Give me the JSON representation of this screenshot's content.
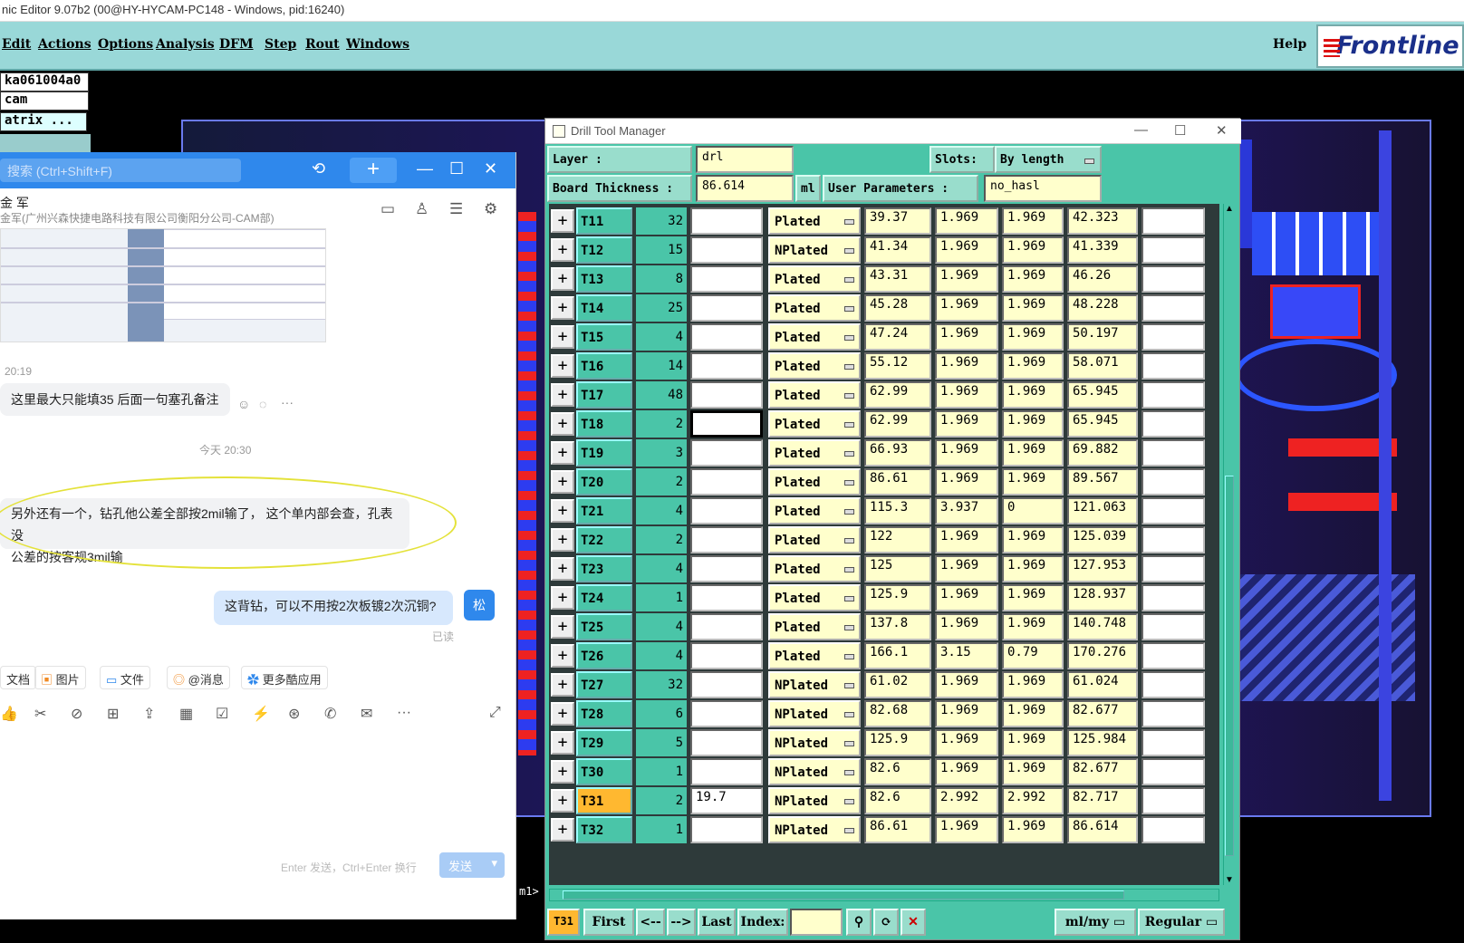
{
  "window": {
    "title": "nic Editor 9.07b2 (00@HY-HYCAM-PC148 - Windows, pid:16240)"
  },
  "menu": {
    "items": [
      "Edit",
      "Actions",
      "Options",
      "Analysis",
      "DFM",
      "Step",
      "Rout",
      "Windows"
    ],
    "help": "Help",
    "logo": "Frontline"
  },
  "left_panel": {
    "job": "ka061004a0",
    "user": "cam",
    "matrix": "atrix ...",
    "coords": "m1>"
  },
  "chat": {
    "search_placeholder": "搜索 (Ctrl+Shift+F)",
    "plus_label": "+",
    "contact_name": "金  军",
    "contact_org": "金军(广州兴森快捷电路科技有限公司衡阳分公司-CAM部)",
    "time1": "20:19",
    "msg1": "这里最大只能填35 后面一句塞孔备注",
    "time2": "今天 20:30",
    "msg2_line1": "另外还有一个，钻孔他公差全部按2mil输了， 这个单内部会查，孔表没",
    "msg2_line2": "公差的按客规3mil输",
    "my_msg": "这背钻，可以不用按2次板镀2次沉铜?",
    "my_avatar": "松",
    "read": "已读",
    "chips": [
      "文档",
      "图片",
      "文件",
      "@消息",
      "更多酷应用"
    ],
    "send_hint": "Enter 发送，Ctrl+Enter 换行",
    "send": "发送"
  },
  "dtm": {
    "title": "Drill Tool Manager",
    "layer_label": "Layer        :",
    "layer_value": "drl",
    "slots_label": "Slots:",
    "slots_value": "By length",
    "thick_label": "Board Thickness  :",
    "thick_value": "86.614",
    "thick_unit": "ml",
    "user_params_label": "User Parameters  :",
    "user_params_value": "no_hasl",
    "rows": [
      {
        "tool": "T11",
        "count": "32",
        "finish": "",
        "type": "Plated",
        "d1": "39.37",
        "d2": "1.969",
        "d3": "1.969",
        "d4": "42.323",
        "d5": ""
      },
      {
        "tool": "T12",
        "count": "15",
        "finish": "",
        "type": "NPlated",
        "d1": "41.34",
        "d2": "1.969",
        "d3": "1.969",
        "d4": "41.339",
        "d5": ""
      },
      {
        "tool": "T13",
        "count": "8",
        "finish": "",
        "type": "Plated",
        "d1": "43.31",
        "d2": "1.969",
        "d3": "1.969",
        "d4": "46.26",
        "d5": ""
      },
      {
        "tool": "T14",
        "count": "25",
        "finish": "",
        "type": "Plated",
        "d1": "45.28",
        "d2": "1.969",
        "d3": "1.969",
        "d4": "48.228",
        "d5": ""
      },
      {
        "tool": "T15",
        "count": "4",
        "finish": "",
        "type": "Plated",
        "d1": "47.24",
        "d2": "1.969",
        "d3": "1.969",
        "d4": "50.197",
        "d5": ""
      },
      {
        "tool": "T16",
        "count": "14",
        "finish": "",
        "type": "Plated",
        "d1": "55.12",
        "d2": "1.969",
        "d3": "1.969",
        "d4": "58.071",
        "d5": ""
      },
      {
        "tool": "T17",
        "count": "48",
        "finish": "",
        "type": "Plated",
        "d1": "62.99",
        "d2": "1.969",
        "d3": "1.969",
        "d4": "65.945",
        "d5": ""
      },
      {
        "tool": "T18",
        "count": "2",
        "finish": "",
        "type": "Plated",
        "d1": "62.99",
        "d2": "1.969",
        "d3": "1.969",
        "d4": "65.945",
        "d5": ""
      },
      {
        "tool": "T19",
        "count": "3",
        "finish": "",
        "type": "Plated",
        "d1": "66.93",
        "d2": "1.969",
        "d3": "1.969",
        "d4": "69.882",
        "d5": ""
      },
      {
        "tool": "T20",
        "count": "2",
        "finish": "",
        "type": "Plated",
        "d1": "86.61",
        "d2": "1.969",
        "d3": "1.969",
        "d4": "89.567",
        "d5": ""
      },
      {
        "tool": "T21",
        "count": "4",
        "finish": "",
        "type": "Plated",
        "d1": "115.3",
        "d2": "3.937",
        "d3": "0",
        "d4": "121.063",
        "d5": ""
      },
      {
        "tool": "T22",
        "count": "2",
        "finish": "",
        "type": "Plated",
        "d1": "122",
        "d2": "1.969",
        "d3": "1.969",
        "d4": "125.039",
        "d5": ""
      },
      {
        "tool": "T23",
        "count": "4",
        "finish": "",
        "type": "Plated",
        "d1": "125",
        "d2": "1.969",
        "d3": "1.969",
        "d4": "127.953",
        "d5": ""
      },
      {
        "tool": "T24",
        "count": "1",
        "finish": "",
        "type": "Plated",
        "d1": "125.9",
        "d2": "1.969",
        "d3": "1.969",
        "d4": "128.937",
        "d5": ""
      },
      {
        "tool": "T25",
        "count": "4",
        "finish": "",
        "type": "Plated",
        "d1": "137.8",
        "d2": "1.969",
        "d3": "1.969",
        "d4": "140.748",
        "d5": ""
      },
      {
        "tool": "T26",
        "count": "4",
        "finish": "",
        "type": "Plated",
        "d1": "166.1",
        "d2": "3.15",
        "d3": "0.79",
        "d4": "170.276",
        "d5": ""
      },
      {
        "tool": "T27",
        "count": "32",
        "finish": "",
        "type": "NPlated",
        "d1": "61.02",
        "d2": "1.969",
        "d3": "1.969",
        "d4": "61.024",
        "d5": ""
      },
      {
        "tool": "T28",
        "count": "6",
        "finish": "",
        "type": "NPlated",
        "d1": "82.68",
        "d2": "1.969",
        "d3": "1.969",
        "d4": "82.677",
        "d5": ""
      },
      {
        "tool": "T29",
        "count": "5",
        "finish": "",
        "type": "NPlated",
        "d1": "125.9",
        "d2": "1.969",
        "d3": "1.969",
        "d4": "125.984",
        "d5": ""
      },
      {
        "tool": "T30",
        "count": "1",
        "finish": "",
        "type": "NPlated",
        "d1": "82.6",
        "d2": "1.969",
        "d3": "1.969",
        "d4": "82.677",
        "d5": ""
      },
      {
        "tool": "T31",
        "count": "2",
        "finish": "19.7",
        "type": "NPlated",
        "d1": "82.6",
        "d2": "2.992",
        "d3": "2.992",
        "d4": "82.717",
        "d5": ""
      },
      {
        "tool": "T32",
        "count": "1",
        "finish": "",
        "type": "NPlated",
        "d1": "86.61",
        "d2": "1.969",
        "d3": "1.969",
        "d4": "86.614",
        "d5": ""
      }
    ],
    "bottom": {
      "current": "T31",
      "first": "First",
      "prev": "<--",
      "next": "-->",
      "last": "Last",
      "index_label": "Index:",
      "units": "ml/my",
      "mode": "Regular"
    }
  }
}
